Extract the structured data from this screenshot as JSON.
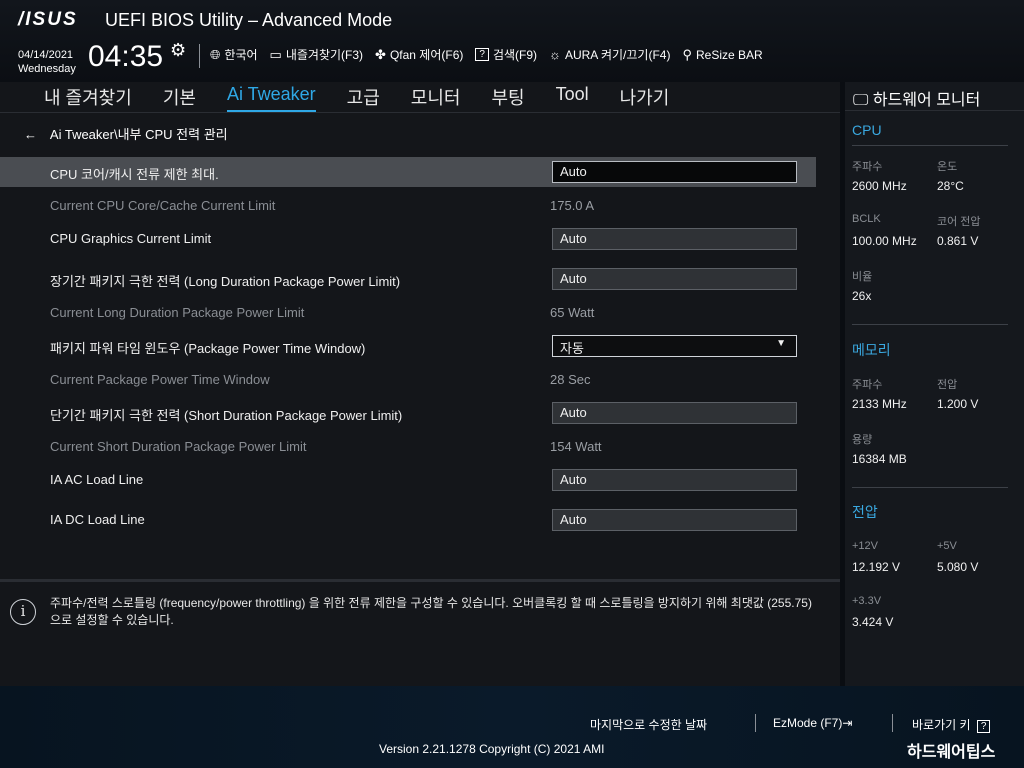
{
  "header": {
    "brand": "/ISUS",
    "title": "UEFI BIOS Utility – Advanced Mode",
    "date": "04/14/2021",
    "day": "Wednesday",
    "time": "04:35",
    "toolbar": [
      {
        "icon": "globe-icon",
        "label": "한국어"
      },
      {
        "icon": "bookmark-icon",
        "label": "내즐겨찾기(F3)"
      },
      {
        "icon": "fan-icon",
        "label": "Qfan 제어(F6)"
      },
      {
        "icon": "help-icon",
        "label": "검색(F9)"
      },
      {
        "icon": "aura-icon",
        "label": "AURA 켜기/끄기(F4)"
      },
      {
        "icon": "resize-bar-icon",
        "label": "ReSize BAR"
      }
    ]
  },
  "tabs": [
    "내 즐겨찾기",
    "기본",
    "Ai Tweaker",
    "고급",
    "모니터",
    "부팅",
    "Tool",
    "나가기"
  ],
  "active_tab": "Ai Tweaker",
  "breadcrumb": "Ai Tweaker\\내부 CPU 전력 관리",
  "settings": [
    {
      "label": "CPU 코어/캐시 전류 제한 최대.",
      "field": "Auto",
      "type": "input-active",
      "selected": true
    },
    {
      "label": "Current CPU Core/Cache Current Limit",
      "value": "175.0 A",
      "type": "readonly"
    },
    {
      "label": "CPU Graphics Current Limit",
      "field": "Auto",
      "type": "input"
    },
    {
      "label": "장기간 패키지 극한 전력 (Long Duration Package Power Limit)",
      "field": "Auto",
      "type": "input"
    },
    {
      "label": "Current Long Duration Package Power Limit",
      "value": "65 Watt",
      "type": "readonly"
    },
    {
      "label": "패키지 파워 타임 윈도우 (Package Power Time Window)",
      "field": "자동",
      "type": "dropdown"
    },
    {
      "label": "Current Package Power Time Window",
      "value": "28 Sec",
      "type": "readonly"
    },
    {
      "label": "단기간 패키지 극한 전력 (Short Duration Package Power Limit)",
      "field": "Auto",
      "type": "input"
    },
    {
      "label": "Current Short Duration Package Power Limit",
      "value": "154 Watt",
      "type": "readonly"
    },
    {
      "label": "IA AC Load Line",
      "field": "Auto",
      "type": "input"
    },
    {
      "label": "IA DC Load Line",
      "field": "Auto",
      "type": "input"
    }
  ],
  "info_text": "주파수/전력 스로틀링 (frequency/power throttling) 을 위한 전류 제한을 구성할 수 있습니다. 오버클록킹 할 때 스로틀링을 방지하기 위해 최댓값 (255.75)으로 설정할 수 있습니다.",
  "hw_monitor": {
    "title": "하드웨어 모니터",
    "cpu": {
      "heading": "CPU",
      "freq_label": "주파수",
      "freq": "2600 MHz",
      "temp_label": "온도",
      "temp": "28°C",
      "bclk_label": "BCLK",
      "bclk": "100.00 MHz",
      "core_v_label": "코어 전압",
      "core_v": "0.861 V",
      "ratio_label": "비율",
      "ratio": "26x"
    },
    "memory": {
      "heading": "메모리",
      "freq_label": "주파수",
      "freq": "2133 MHz",
      "volt_label": "전압",
      "volt": "1.200 V",
      "cap_label": "용량",
      "cap": "16384 MB"
    },
    "voltage": {
      "heading": "전압",
      "v12_label": "+12V",
      "v12": "12.192 V",
      "v5_label": "+5V",
      "v5": "5.080 V",
      "v33_label": "+3.3V",
      "v33": "3.424 V"
    }
  },
  "footer": {
    "last_modified": "마지막으로 수정한 날짜",
    "ezmode": "EzMode (F7)⇥",
    "hotkeys": "바로가기 키",
    "version": "Version 2.21.1278 Copyright (C) 2021 AMI",
    "watermark": "하드웨어팁스"
  }
}
